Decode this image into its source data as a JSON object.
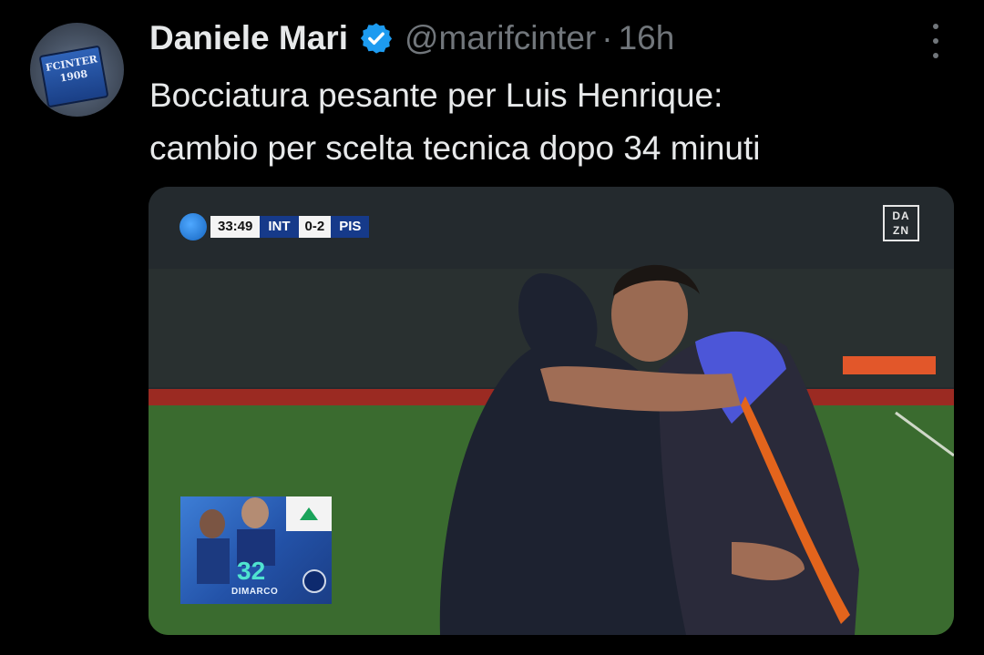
{
  "tweet": {
    "author_name": "Daniele Mari",
    "handle": "@marifcinter",
    "separator": "·",
    "time": "16h",
    "text_line1": "Bocciatura pesante per Luis Henrique:",
    "text_line2": "cambio per scelta tecnica dopo 34 minuti",
    "avatar_text": "FCINTER 1908",
    "icons": {
      "verified": "verified-badge-icon",
      "more": "more-options-icon"
    },
    "colors": {
      "verified": "#1d9bf0",
      "muted": "#71767b",
      "text": "#e7e9ea",
      "background": "#000000"
    }
  },
  "media": {
    "scorebug": {
      "clock": "33:49",
      "home": "INT",
      "score": "0-2",
      "away": "PIS"
    },
    "broadcaster_logo": "DA ZN",
    "sub_card": {
      "number": "32",
      "player": "DIMARCO"
    }
  }
}
